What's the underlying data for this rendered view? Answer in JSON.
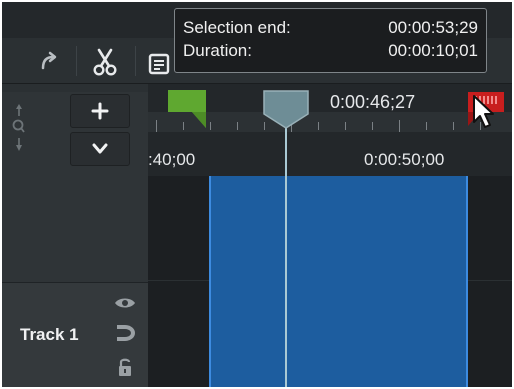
{
  "tooltip": {
    "selection_end_label": "Selection end:",
    "selection_end_value": "00:00:53;29",
    "duration_label": "Duration:",
    "duration_value": "00:00:10;01"
  },
  "ruler": {
    "playhead_time": "0:00:46;27",
    "tick_labels": [
      ":40;00",
      "0:00:50;00"
    ]
  },
  "track": {
    "name": "Track 1"
  },
  "icons": {
    "redo": "redo-arrow-icon",
    "cut": "scissors-icon",
    "paste": "clipboard-icon",
    "zoom": "zoom-icon",
    "add": "plus-icon",
    "expand": "chevron-down-icon",
    "visibility": "eye-icon",
    "magnet": "magnet-icon",
    "lock": "lock-icon",
    "in_marker": "in-point-marker",
    "out_marker": "out-point-marker",
    "playhead": "playhead-icon",
    "cursor": "mouse-cursor-icon"
  },
  "colors": {
    "in_marker": "#5fa830",
    "out_marker": "#c81e1e",
    "playhead": "#6e8d96",
    "selection": "#1d5d9f",
    "selection_border": "#3d8be0"
  }
}
